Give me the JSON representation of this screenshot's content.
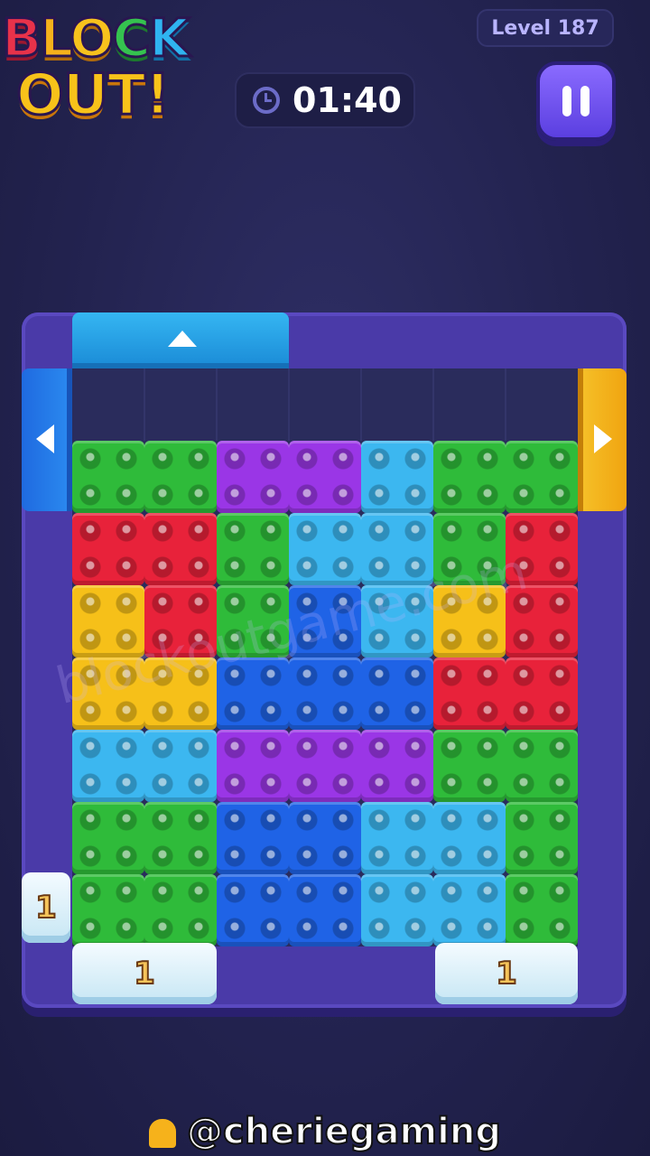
{
  "logo": {
    "line1": [
      "B",
      "L",
      "O",
      "C",
      "K"
    ],
    "line2": "OUT!"
  },
  "level": {
    "label": "Level 187"
  },
  "timer": {
    "value": "01:40"
  },
  "pause": {
    "icon": "pause-icon"
  },
  "colors": {
    "green": "#2fbb3a",
    "purple": "#9a36e6",
    "cyan": "#3cb7f0",
    "red": "#e8223a",
    "yellow": "#f6c019",
    "blue": "#1f63e6",
    "frame": "#4a3aa8"
  },
  "board": {
    "cols": 7,
    "rows": 8,
    "empty_row": 0,
    "cells": [
      [
        "",
        "",
        "",
        "",
        "",
        "",
        ""
      ],
      [
        "green",
        "green",
        "purple",
        "purple",
        "cyan",
        "green",
        "green"
      ],
      [
        "red",
        "red",
        "green",
        "cyan",
        "cyan",
        "green",
        "red"
      ],
      [
        "yellow",
        "red",
        "green",
        "blue",
        "cyan",
        "yellow",
        "red"
      ],
      [
        "yellow",
        "yellow",
        "blue",
        "blue",
        "blue",
        "red",
        "red"
      ],
      [
        "cyan",
        "cyan",
        "purple",
        "purple",
        "purple",
        "green",
        "green"
      ],
      [
        "green",
        "green",
        "blue",
        "blue",
        "cyan",
        "cyan",
        "green"
      ],
      [
        "green",
        "green",
        "blue",
        "blue",
        "cyan",
        "cyan",
        "green"
      ]
    ],
    "exits": [
      {
        "side": "top",
        "color": "cyan",
        "icon": "arrow-up-icon"
      },
      {
        "side": "left",
        "color": "blue",
        "icon": "arrow-left-icon"
      },
      {
        "side": "right",
        "color": "yellow",
        "icon": "arrow-right-icon"
      }
    ],
    "ice_blocks": [
      {
        "name": "ice-block-left",
        "count": "1"
      },
      {
        "name": "ice-block-bottom-left",
        "count": "1"
      },
      {
        "name": "ice-block-bottom-right",
        "count": "1"
      }
    ]
  },
  "watermark": "blockoutgame.com",
  "handle": "@cheriegaming"
}
